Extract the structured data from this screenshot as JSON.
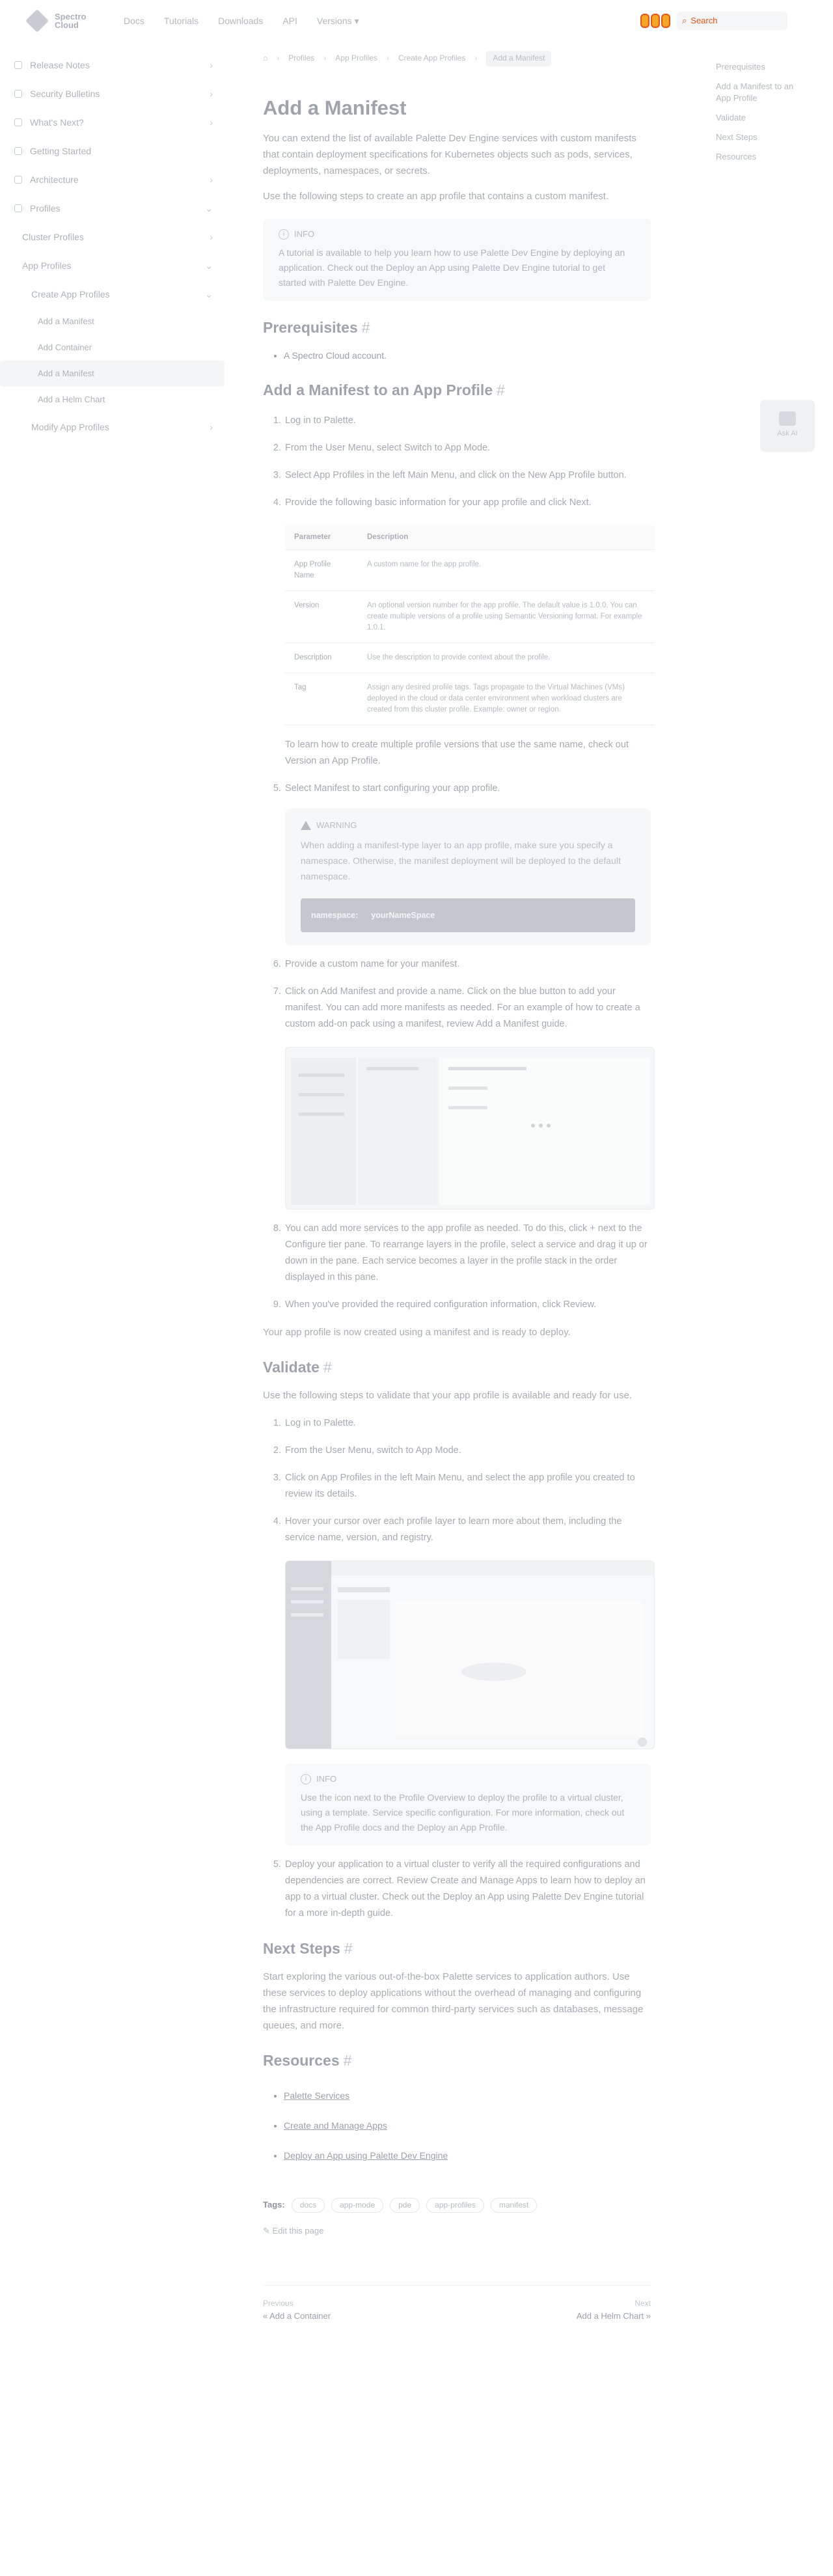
{
  "header": {
    "logo_text": "Spectro Cloud",
    "nav": [
      "Docs",
      "Tutorials",
      "Downloads",
      "API",
      "Versions"
    ],
    "search_label": "Search"
  },
  "sidebar": {
    "items": [
      {
        "label": "Release Notes"
      },
      {
        "label": "Security Bulletins"
      },
      {
        "label": "What's Next?"
      },
      {
        "label": "Getting Started"
      },
      {
        "label": "Architecture"
      },
      {
        "label": "Profiles"
      },
      {
        "label": "Cluster Profiles"
      },
      {
        "label": "App Profiles"
      },
      {
        "label": "Create App Profiles"
      },
      {
        "label": "Add a Manifest"
      },
      {
        "label": "Add Container"
      },
      {
        "label": "Add a Helm Chart"
      },
      {
        "label": "Modify App Profiles"
      }
    ]
  },
  "breadcrumbs": [
    "Profiles",
    "App Profiles",
    "Create App Profiles",
    "Add a Manifest"
  ],
  "page": {
    "title": "Add a Manifest",
    "intro": "You can extend the list of available Palette Dev Engine services with custom manifests that contain deployment specifications for Kubernetes objects such as pods, services, deployments, namespaces, or secrets.",
    "intro2": "Use the following steps to create an app profile that contains a custom manifest.",
    "info_title": "INFO",
    "info_body": "A tutorial is available to help you learn how to use Palette Dev Engine by deploying an application. Check out the Deploy an App using Palette Dev Engine tutorial to get started with Palette Dev Engine.",
    "prereq_heading": "Prerequisites",
    "prereq_item": "A Spectro Cloud account.",
    "add_heading": "Add a Manifest to an App Profile",
    "steps": [
      "Log in to Palette.",
      "From the User Menu, select Switch to App Mode.",
      "Select App Profiles in the left Main Menu, and click on the New App Profile button.",
      "Provide the following basic information for your app profile and click Next."
    ],
    "table": {
      "headers": [
        "Parameter",
        "Description"
      ],
      "rows": [
        [
          "App Profile Name",
          "A custom name for the app profile."
        ],
        [
          "Version",
          "An optional version number for the app profile. The default value is 1.0.0. You can create multiple versions of a profile using Semantic Versioning format. For example 1.0.1."
        ],
        [
          "Description",
          "Use the description to provide context about the profile."
        ],
        [
          "Tag",
          "Assign any desired profile tags. Tags propagate to the Virtual Machines (VMs) deployed in the cloud or data center environment when workload clusters are created from this cluster profile. Example: owner or region."
        ]
      ]
    },
    "table_note": "To learn how to create multiple profile versions that use the same name, check out Version an App Profile.",
    "step5": "Select Manifest to start configuring your app profile.",
    "warn_title": "WARNING",
    "warn_body": "When adding a manifest-type layer to an app profile, make sure you specify a namespace. Otherwise, the manifest deployment will be deployed to the default namespace.",
    "warn_bar_left": "namespace:",
    "warn_bar_right": "yourNameSpace",
    "step6": "Provide a custom name for your manifest.",
    "step7": "Click on Add Manifest and provide a name. Click on the blue button to add your manifest. You can add more manifests as needed. For an example of how to create a custom add-on pack using a manifest, review Add a Manifest guide.",
    "step8": "You can add more services to the app profile as needed. To do this, click + next to the Configure tier pane. To rearrange layers in the profile, select a service and drag it up or down in the pane. Each service becomes a layer in the profile stack in the order displayed in this pane.",
    "step9": "When you've provided the required configuration information, click Review.",
    "ready": "Your app profile is now created using a manifest and is ready to deploy.",
    "validate_heading": "Validate",
    "validate_intro": "Use the following steps to validate that your app profile is available and ready for use.",
    "vsteps": [
      "Log in to Palette.",
      "From the User Menu, switch to App Mode.",
      "Click on App Profiles in the left Main Menu, and select the app profile you created to review its details.",
      "Hover your cursor over each profile layer to learn more about them, including the service name, version, and registry."
    ],
    "info2_title": "INFO",
    "info2_body": "Use the icon next to the Profile Overview to deploy the profile to a virtual cluster, using a template. Service specific configuration. For more information, check out the App Profile docs and the Deploy an App Profile.",
    "vstep5": "Deploy your application to a virtual cluster to verify all the required configurations and dependencies are correct. Review Create and Manage Apps to learn how to deploy an app to a virtual cluster. Check out the Deploy an App using Palette Dev Engine tutorial for a more in-depth guide.",
    "next_heading": "Next Steps",
    "next_body": "Start exploring the various out-of-the-box Palette services to application authors. Use these services to deploy applications without the overhead of managing and configuring the infrastructure required for common third-party services such as databases, message queues, and more.",
    "resources_heading": "Resources",
    "resources": [
      "Palette Services",
      "Create and Manage Apps",
      "Deploy an App using Palette Dev Engine"
    ],
    "tags_label": "Tags:",
    "tags": [
      "docs",
      "app-mode",
      "pde",
      "app-profiles",
      "manifest"
    ],
    "edit_label": "Edit this page",
    "prev_small": "Previous",
    "prev_label": "« Add a Container",
    "next_small": "Next",
    "next_label": "Add a Helm Chart »"
  },
  "toc": [
    "Prerequisites",
    "Add a Manifest to an App Profile",
    "Validate",
    "Next Steps",
    "Resources"
  ],
  "feedback_label": "Ask AI",
  "colors": {
    "accent": "#e8521a",
    "search_bg": "#f6a623"
  }
}
